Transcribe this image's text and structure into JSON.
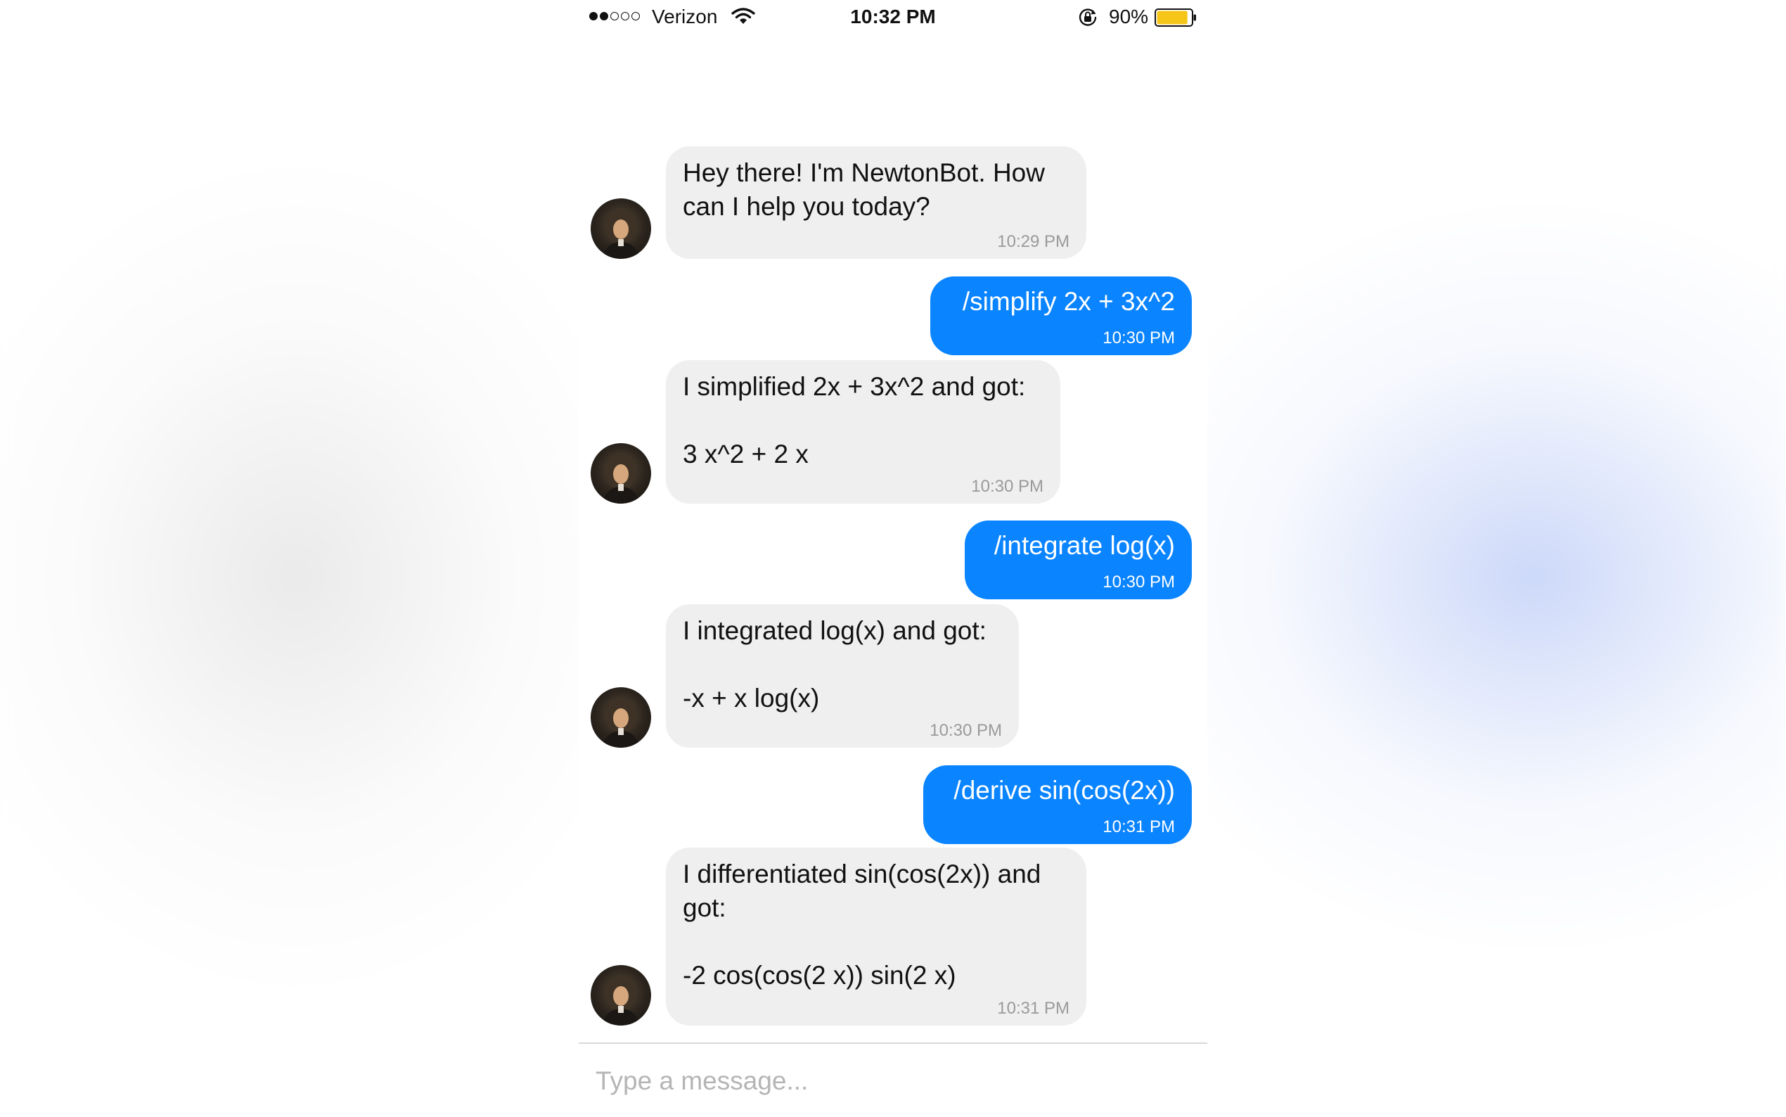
{
  "status_bar": {
    "signal_bars_filled": 2,
    "signal_bars_total": 5,
    "carrier": "Verizon",
    "time": "10:32 PM",
    "battery_percent": "90%",
    "battery_level": 0.9,
    "battery_color": "#f5c518",
    "icons": [
      "signal-dots-icon",
      "wifi-icon",
      "orientation-lock-icon",
      "battery-icon"
    ]
  },
  "chat": {
    "messages": [
      {
        "sender": "bot",
        "text": "Hey there! I'm NewtonBot. How\ncan I help you today?",
        "time": "10:29 PM"
      },
      {
        "sender": "user",
        "text": "/simplify 2x + 3x^2",
        "time": "10:30 PM"
      },
      {
        "sender": "bot",
        "text": "I simplified 2x + 3x^2 and got:\n\n3 x^2 + 2 x",
        "time": "10:30 PM"
      },
      {
        "sender": "user",
        "text": "/integrate log(x)",
        "time": "10:30 PM"
      },
      {
        "sender": "bot",
        "text": "I integrated log(x) and got:\n\n-x + x log(x)",
        "time": "10:30 PM"
      },
      {
        "sender": "user",
        "text": "/derive sin(cos(2x))",
        "time": "10:31 PM"
      },
      {
        "sender": "bot",
        "text": "I differentiated sin(cos(2x)) and\ngot:\n\n-2 cos(cos(2 x)) sin(2 x)",
        "time": "10:31 PM"
      }
    ]
  },
  "composer": {
    "placeholder": "Type a message...",
    "value": ""
  },
  "colors": {
    "user_bubble": "#0a84ff",
    "bot_bubble": "#efefef",
    "timestamp_gray": "#9a9a9a"
  }
}
